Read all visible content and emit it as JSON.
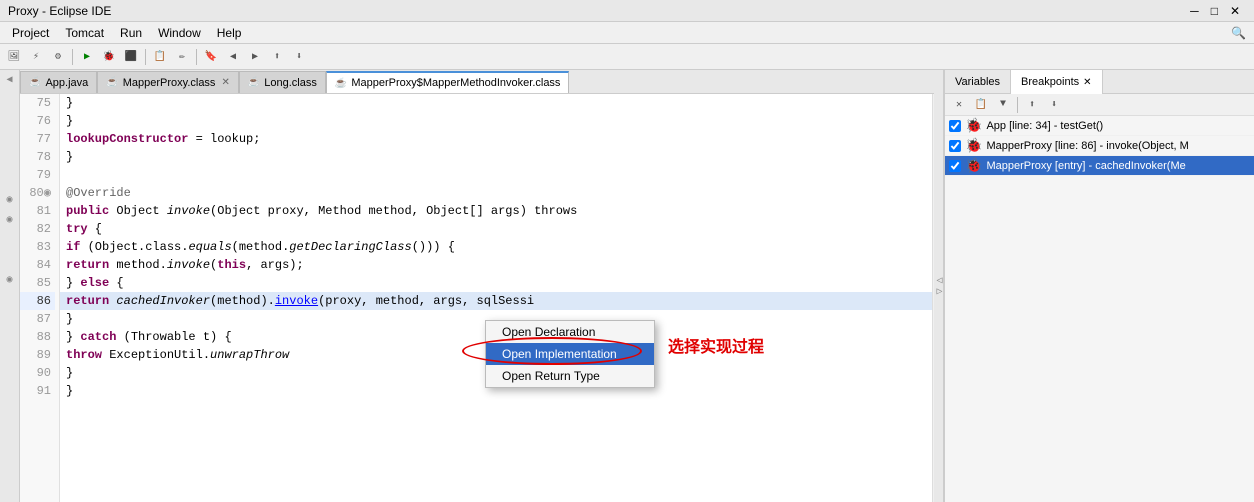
{
  "titleBar": {
    "text": "Proxy - Eclipse IDE"
  },
  "menuBar": {
    "items": [
      "Project",
      "Tomcat",
      "Run",
      "Window",
      "Help"
    ]
  },
  "tabs": [
    {
      "id": "app-java",
      "label": "App.java",
      "icon": "☕",
      "active": false,
      "closable": false
    },
    {
      "id": "mapperpoxy-class",
      "label": "MapperProxy.class",
      "icon": "☕",
      "active": false,
      "closable": true
    },
    {
      "id": "long-class",
      "label": "Long.class",
      "icon": "☕",
      "active": false,
      "closable": false
    },
    {
      "id": "mapperproxy-invoker",
      "label": "MapperProxy$MapperMethodInvoker.class",
      "icon": "☕",
      "active": true,
      "closable": false
    }
  ],
  "lines": [
    {
      "num": "75",
      "code": "        }"
    },
    {
      "num": "76",
      "code": "    }"
    },
    {
      "num": "77",
      "code": "    lookupConstructor = lookup;",
      "isLookup": true
    },
    {
      "num": "78",
      "code": "  }"
    },
    {
      "num": "79",
      "code": ""
    },
    {
      "num": "80",
      "code": "  @Override",
      "isAnnotation": true,
      "hasBreakpoint": false,
      "isOverride": true
    },
    {
      "num": "81",
      "code": "  public Object invoke(Object proxy, Method method, Object[] args) throws"
    },
    {
      "num": "82",
      "code": "    try {"
    },
    {
      "num": "83",
      "code": "      if (Object.class.equals(method.getDeclaringClass())) {"
    },
    {
      "num": "84",
      "code": "        return method.invoke(this, args);"
    },
    {
      "num": "85",
      "code": "      } else {"
    },
    {
      "num": "86",
      "code": "        return cachedInvoker(method).invoke(proxy, method, args, sqlSessi",
      "isHighlighted": true,
      "hasBreakpoint": true
    },
    {
      "num": "87",
      "code": "    }"
    },
    {
      "num": "88",
      "code": "  } catch (Throwable t) {"
    },
    {
      "num": "89",
      "code": "      throw ExceptionUtil.unwrapThrow"
    },
    {
      "num": "90",
      "code": "  }"
    },
    {
      "num": "91",
      "code": "}"
    }
  ],
  "contextMenu": {
    "items": [
      {
        "id": "open-declaration",
        "label": "Open Declaration"
      },
      {
        "id": "open-implementation",
        "label": "Open Implementation"
      },
      {
        "id": "open-return-type",
        "label": "Open Return Type"
      }
    ]
  },
  "annotation": {
    "text": "选择实现过程"
  },
  "rightPanel": {
    "tabs": [
      "Variables",
      "Breakpoints"
    ],
    "activeTab": "Breakpoints",
    "debugItems": [
      {
        "label": "App [line: 34] - testGet()",
        "checked": true
      },
      {
        "label": "MapperProxy [line: 86] - invoke(Object, M",
        "checked": true,
        "selected": false
      },
      {
        "label": "MapperProxy [entry] - cachedInvoker(Me",
        "checked": true,
        "selected": true
      }
    ]
  }
}
